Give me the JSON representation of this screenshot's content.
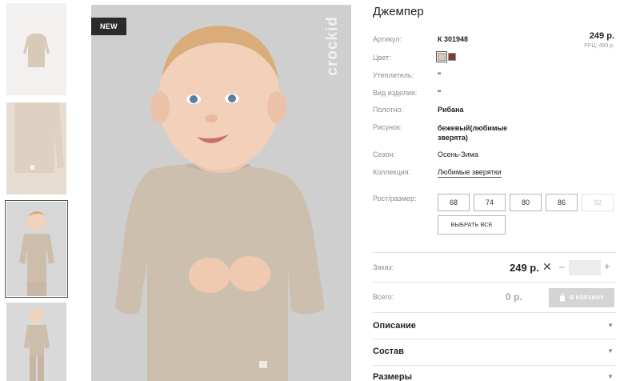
{
  "gallery": {
    "badge": "NEW",
    "brand": "crockid"
  },
  "product": {
    "title": "Джемпер",
    "price": "249 р.",
    "rrp": "РРЦ: 499 р.",
    "colors": [
      "#d9c9b0",
      "#7a3f2e"
    ]
  },
  "details": [
    {
      "label": "Артикул:",
      "value": "К 301948",
      "style": "bold"
    },
    {
      "label": "Цвет:",
      "value": "",
      "style": "swatches"
    },
    {
      "label": "Утеплитель:",
      "value": "\"",
      "style": "bold"
    },
    {
      "label": "Вид изделия:",
      "value": "\"",
      "style": "bold"
    },
    {
      "label": "Полотно:",
      "value": "Рибана",
      "style": "bold"
    },
    {
      "label": "Рисунок:",
      "value": "бежевый(любимые зверята)",
      "style": "bold"
    },
    {
      "label": "Сезон:",
      "value": "Осень-Зима",
      "style": "normal"
    },
    {
      "label": "Коллекция:",
      "value": "Любимые зверятки",
      "style": "link"
    }
  ],
  "sizes": {
    "label": "Рост/размер:",
    "options": [
      {
        "value": "68",
        "available": true
      },
      {
        "value": "74",
        "available": true
      },
      {
        "value": "80",
        "available": true
      },
      {
        "value": "86",
        "available": true
      },
      {
        "value": "92",
        "available": false
      }
    ],
    "select_all": "ВЫБРАТЬ ВСЕ"
  },
  "order": {
    "label": "Заказ:",
    "price": "249 р.",
    "clear": "✕",
    "minus": "–",
    "plus": "+",
    "quantity": ""
  },
  "total": {
    "label": "Всего:",
    "value": "0 р.",
    "cart_button": "В КОРЗИНУ"
  },
  "sections": [
    {
      "title": "Описание"
    },
    {
      "title": "Состав"
    },
    {
      "title": "Размеры"
    }
  ]
}
